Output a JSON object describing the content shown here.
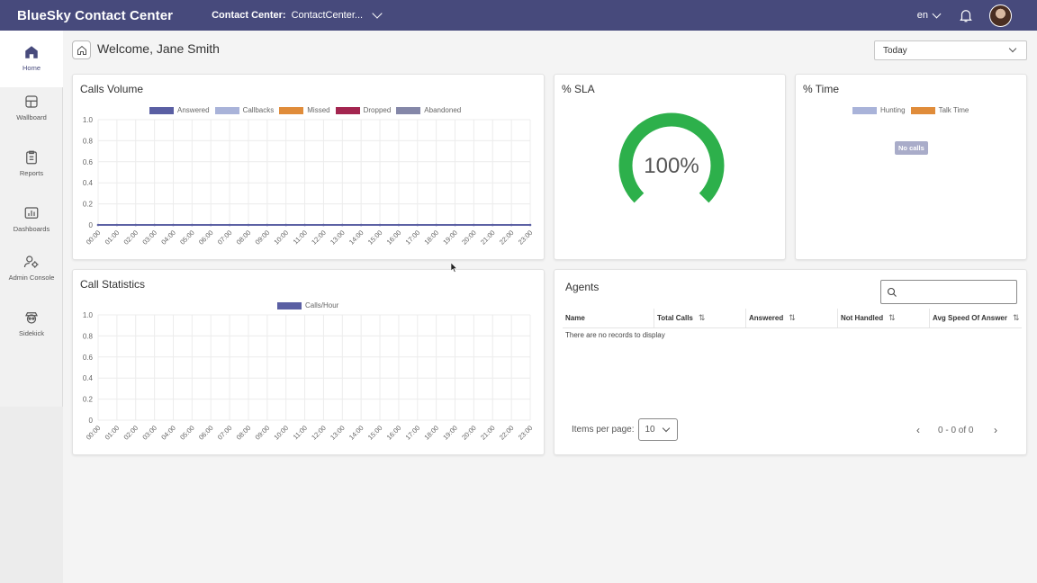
{
  "header": {
    "brand": "BlueSky Contact Center",
    "contact_center_label": "Contact Center:",
    "contact_center_value": "ContactCenter...",
    "language": "en"
  },
  "sidebar": {
    "items": [
      {
        "label": "Home",
        "icon": "home-icon"
      },
      {
        "label": "Wallboard",
        "icon": "wallboard-icon"
      },
      {
        "label": "Reports",
        "icon": "reports-icon"
      },
      {
        "label": "Dashboards",
        "icon": "dashboards-icon"
      },
      {
        "label": "Admin Console",
        "icon": "admin-console-icon"
      },
      {
        "label": "Sidekick",
        "icon": "sidekick-icon"
      }
    ]
  },
  "main": {
    "welcome": "Welcome, Jane Smith",
    "date_range": "Today"
  },
  "calls_volume": {
    "title": "Calls Volume",
    "legend": [
      {
        "name": "Answered",
        "color": "#5a5fa3"
      },
      {
        "name": "Callbacks",
        "color": "#a9b3d9"
      },
      {
        "name": "Missed",
        "color": "#e08c3a"
      },
      {
        "name": "Dropped",
        "color": "#a3254f"
      },
      {
        "name": "Abandoned",
        "color": "#8487a8"
      }
    ]
  },
  "call_statistics": {
    "title": "Call Statistics",
    "legend": [
      {
        "name": "Calls/Hour",
        "color": "#5a5fa3"
      }
    ]
  },
  "sla": {
    "title": "% SLA",
    "value_label": "100%",
    "color": "#2db04b"
  },
  "time": {
    "title": "% Time",
    "legend": [
      {
        "name": "Hunting",
        "color": "#a9b3d9"
      },
      {
        "name": "Talk Time",
        "color": "#e08c3a"
      }
    ],
    "empty_label": "No calls"
  },
  "agents": {
    "title": "Agents",
    "columns": [
      {
        "label": "Name",
        "sortable": false
      },
      {
        "label": "Total Calls",
        "sortable": true
      },
      {
        "label": "Answered",
        "sortable": true
      },
      {
        "label": "Not Handled",
        "sortable": true
      },
      {
        "label": "Avg Speed Of Answer",
        "sortable": true
      }
    ],
    "empty_text": "There are no records to display",
    "items_per_page_label": "Items per page:",
    "items_per_page": "10",
    "range": "0 - 0 of 0"
  },
  "chart_data": [
    {
      "type": "line",
      "title": "Calls Volume",
      "x": [
        "00:00",
        "01:00",
        "02:00",
        "03:00",
        "04:00",
        "05:00",
        "06:00",
        "07:00",
        "08:00",
        "09:00",
        "10:00",
        "11:00",
        "12:00",
        "13:00",
        "14:00",
        "15:00",
        "16:00",
        "17:00",
        "18:00",
        "19:00",
        "20:00",
        "21:00",
        "22:00",
        "23:00"
      ],
      "yticks": [
        "0",
        "0.2",
        "0.4",
        "0.6",
        "0.8",
        "1.0"
      ],
      "ylim": [
        0,
        1
      ],
      "series": [
        {
          "name": "Answered",
          "values": [
            0,
            0,
            0,
            0,
            0,
            0,
            0,
            0,
            0,
            0,
            0,
            0,
            0,
            0,
            0,
            0,
            0,
            0,
            0,
            0,
            0,
            0,
            0,
            0
          ]
        },
        {
          "name": "Callbacks",
          "values": [
            0,
            0,
            0,
            0,
            0,
            0,
            0,
            0,
            0,
            0,
            0,
            0,
            0,
            0,
            0,
            0,
            0,
            0,
            0,
            0,
            0,
            0,
            0,
            0
          ]
        },
        {
          "name": "Missed",
          "values": [
            0,
            0,
            0,
            0,
            0,
            0,
            0,
            0,
            0,
            0,
            0,
            0,
            0,
            0,
            0,
            0,
            0,
            0,
            0,
            0,
            0,
            0,
            0,
            0
          ]
        },
        {
          "name": "Dropped",
          "values": [
            0,
            0,
            0,
            0,
            0,
            0,
            0,
            0,
            0,
            0,
            0,
            0,
            0,
            0,
            0,
            0,
            0,
            0,
            0,
            0,
            0,
            0,
            0,
            0
          ]
        },
        {
          "name": "Abandoned",
          "values": [
            0,
            0,
            0,
            0,
            0,
            0,
            0,
            0,
            0,
            0,
            0,
            0,
            0,
            0,
            0,
            0,
            0,
            0,
            0,
            0,
            0,
            0,
            0,
            0
          ]
        }
      ],
      "grid": true,
      "legend_position": "top"
    },
    {
      "type": "bar",
      "title": "Call Statistics",
      "x": [
        "00:00",
        "01:00",
        "02:00",
        "03:00",
        "04:00",
        "05:00",
        "06:00",
        "07:00",
        "08:00",
        "09:00",
        "10:00",
        "11:00",
        "12:00",
        "13:00",
        "14:00",
        "15:00",
        "16:00",
        "17:00",
        "18:00",
        "19:00",
        "20:00",
        "21:00",
        "22:00",
        "23:00"
      ],
      "yticks": [
        "0",
        "0.2",
        "0.4",
        "0.6",
        "0.8",
        "1.0"
      ],
      "ylim": [
        0,
        1
      ],
      "series": [
        {
          "name": "Calls/Hour",
          "values": [
            0,
            0,
            0,
            0,
            0,
            0,
            0,
            0,
            0,
            0,
            0,
            0,
            0,
            0,
            0,
            0,
            0,
            0,
            0,
            0,
            0,
            0,
            0,
            0
          ]
        }
      ],
      "grid": true,
      "legend_position": "top"
    },
    {
      "type": "pie",
      "title": "% SLA",
      "values": [
        100
      ],
      "center_label": "100%"
    }
  ]
}
